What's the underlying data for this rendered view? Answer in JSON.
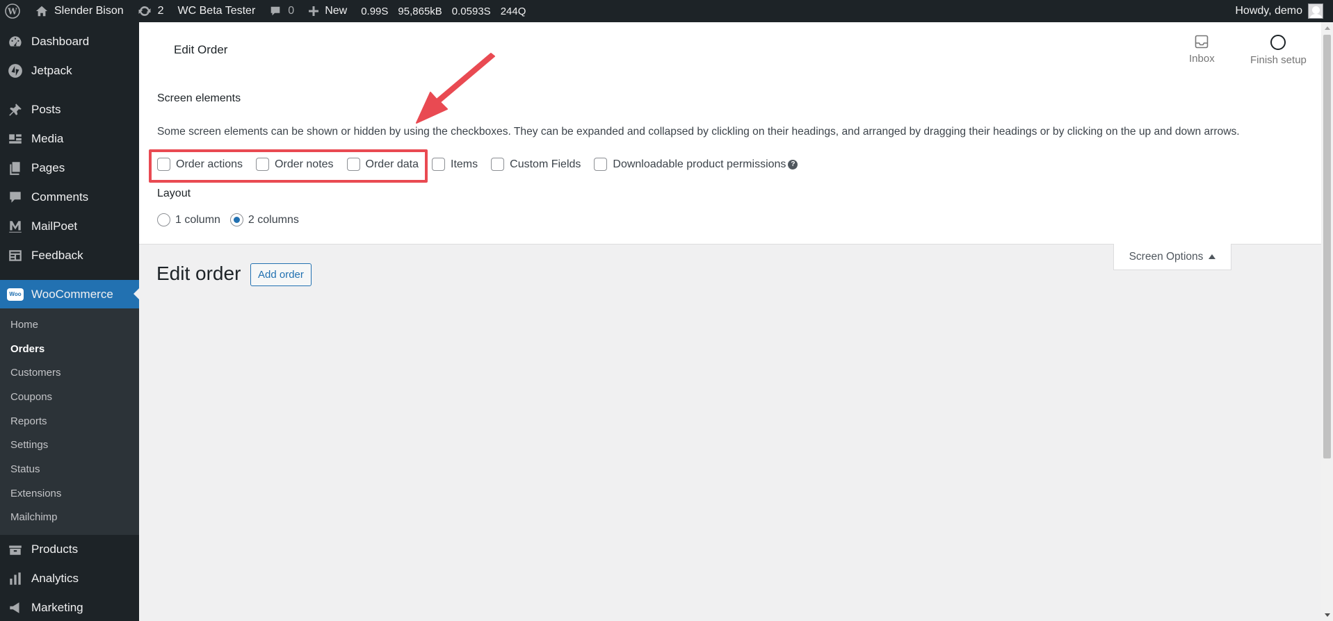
{
  "admin_bar": {
    "site_name": "Slender Bison",
    "updates_count": "2",
    "plugin": "WC Beta Tester",
    "comments_count": "0",
    "new_label": "New",
    "perf_time": "0.99S",
    "perf_memory": "95,865kB",
    "perf_query_time": "0.0593S",
    "perf_queries": "244Q",
    "greeting": "Howdy, demo"
  },
  "sidebar": {
    "top_items": [
      {
        "label": "Dashboard",
        "icon": "dashboard-icon"
      },
      {
        "label": "Jetpack",
        "icon": "jetpack-icon"
      }
    ],
    "content_items": [
      {
        "label": "Posts",
        "icon": "pin-icon"
      },
      {
        "label": "Media",
        "icon": "media-icon"
      },
      {
        "label": "Pages",
        "icon": "pages-icon"
      },
      {
        "label": "Comments",
        "icon": "comments-icon"
      },
      {
        "label": "MailPoet",
        "icon": "mailpoet-icon"
      },
      {
        "label": "Feedback",
        "icon": "feedback-icon"
      }
    ],
    "woocommerce": {
      "label": "WooCommerce",
      "badge": "Woo",
      "submenu": [
        "Home",
        "Orders",
        "Customers",
        "Coupons",
        "Reports",
        "Settings",
        "Status",
        "Extensions",
        "Mailchimp"
      ],
      "current": "Orders"
    },
    "bottom_items": [
      {
        "label": "Products",
        "icon": "products-icon"
      },
      {
        "label": "Analytics",
        "icon": "analytics-icon"
      },
      {
        "label": "Marketing",
        "icon": "marketing-icon"
      }
    ]
  },
  "header": {
    "title": "Edit Order",
    "inbox_label": "Inbox",
    "finish_setup_label": "Finish setup"
  },
  "screen_options": {
    "elements_title": "Screen elements",
    "description": "Some screen elements can be shown or hidden by using the checkboxes. They can be expanded and collapsed by clickling on their headings, and arranged by dragging their headings or by clicking on the up and down arrows.",
    "checkboxes": [
      "Order actions",
      "Order notes",
      "Order data",
      "Items",
      "Custom Fields",
      "Downloadable product permissions"
    ],
    "layout_title": "Layout",
    "layout_options": [
      "1 column",
      "2 columns"
    ],
    "layout_selected": "2 columns",
    "tab_label": "Screen Options"
  },
  "main": {
    "title": "Edit order",
    "add_button": "Add order"
  },
  "colors": {
    "accent": "#2271b1",
    "sidebar_bg": "#1d2327",
    "highlight": "#e94a52"
  }
}
